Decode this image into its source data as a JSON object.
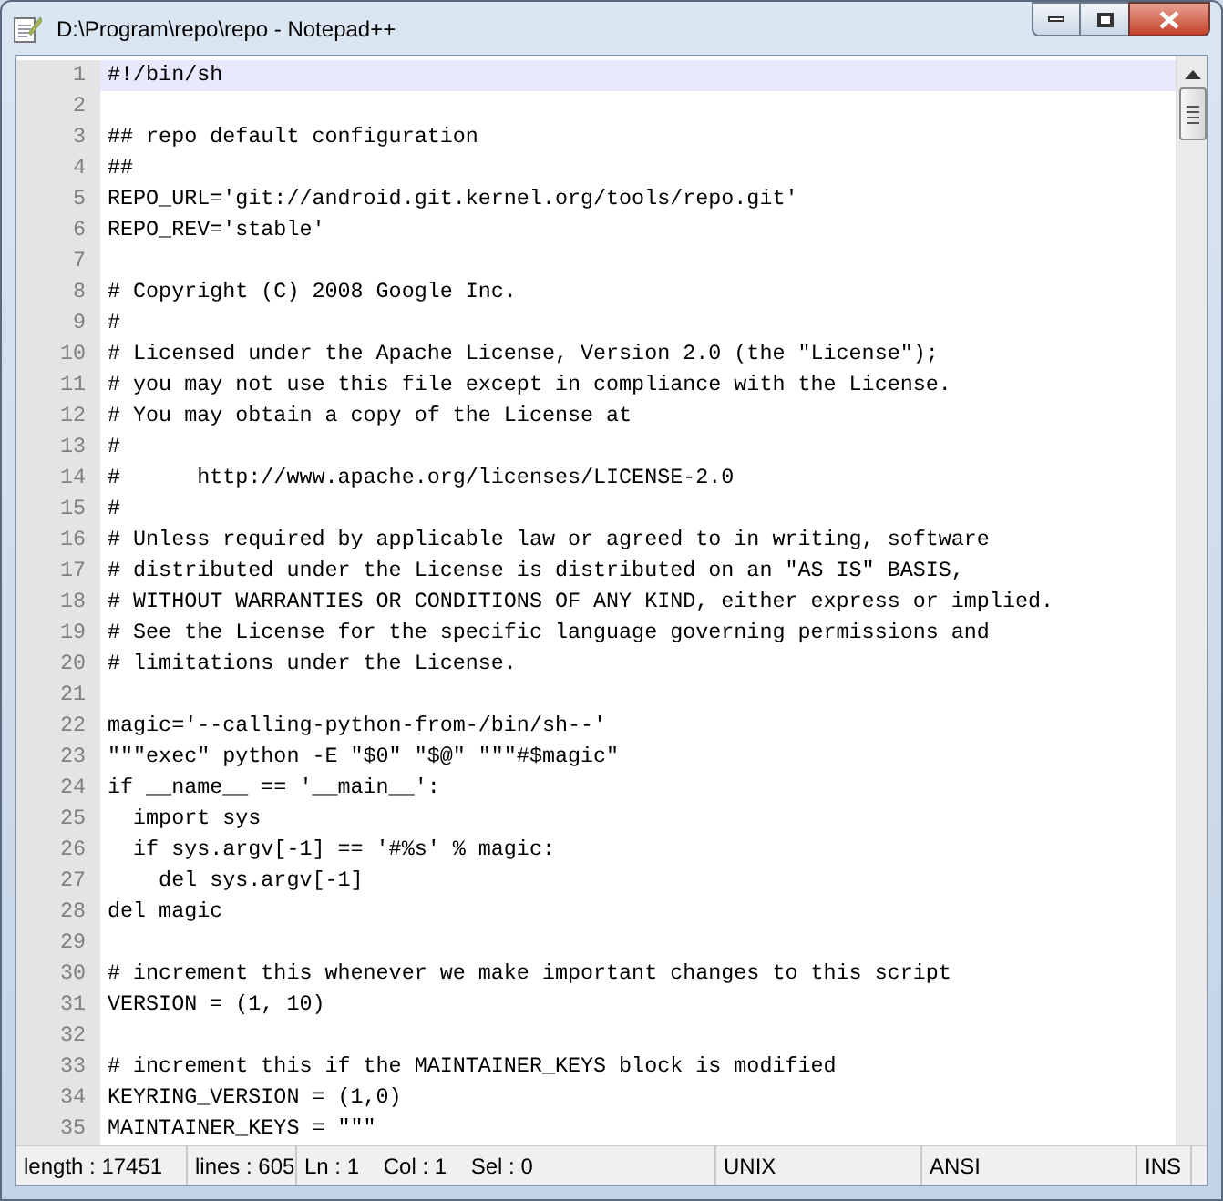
{
  "window": {
    "title": "D:\\Program\\repo\\repo - Notepad++"
  },
  "editor": {
    "lines": [
      {
        "number": "1",
        "text": "#!/bin/sh",
        "current": true
      },
      {
        "number": "2",
        "current": false
      },
      {
        "number": "3",
        "text": "## repo default configuration",
        "current": false
      },
      {
        "number": "4",
        "text": "##",
        "current": false
      },
      {
        "number": "5",
        "text": "REPO_URL='git://android.git.kernel.org/tools/repo.git'",
        "current": false
      },
      {
        "number": "6",
        "text": "REPO_REV='stable'",
        "current": false
      },
      {
        "number": "7",
        "current": false
      },
      {
        "number": "8",
        "text": "# Copyright (C) 2008 Google Inc.",
        "current": false
      },
      {
        "number": "9",
        "text": "#",
        "current": false
      },
      {
        "number": "10",
        "text": "# Licensed under the Apache License, Version 2.0 (the \"License\");",
        "current": false
      },
      {
        "number": "11",
        "text": "# you may not use this file except in compliance with the License.",
        "current": false
      },
      {
        "number": "12",
        "text": "# You may obtain a copy of the License at",
        "current": false
      },
      {
        "number": "13",
        "text": "#",
        "current": false
      },
      {
        "number": "14",
        "text": "#      http://www.apache.org/licenses/LICENSE-2.0",
        "current": false
      },
      {
        "number": "15",
        "text": "#",
        "current": false
      },
      {
        "number": "16",
        "text": "# Unless required by applicable law or agreed to in writing, software",
        "current": false
      },
      {
        "number": "17",
        "text": "# distributed under the License is distributed on an \"AS IS\" BASIS,",
        "current": false
      },
      {
        "number": "18",
        "text": "# WITHOUT WARRANTIES OR CONDITIONS OF ANY KIND, either express or implied.",
        "current": false
      },
      {
        "number": "19",
        "text": "# See the License for the specific language governing permissions and",
        "current": false
      },
      {
        "number": "20",
        "text": "# limitations under the License.",
        "current": false
      },
      {
        "number": "21",
        "current": false
      },
      {
        "number": "22",
        "text": "magic='--calling-python-from-/bin/sh--'",
        "current": false
      },
      {
        "number": "23",
        "text": "\"\"\"exec\" python -E \"$0\" \"$@\" \"\"\"#$magic\"",
        "current": false
      },
      {
        "number": "24",
        "text": "if __name__ == '__main__':",
        "current": false
      },
      {
        "number": "25",
        "text": "  import sys",
        "current": false
      },
      {
        "number": "26",
        "text": "  if sys.argv[-1] == '#%s' % magic:",
        "current": false
      },
      {
        "number": "27",
        "text": "    del sys.argv[-1]",
        "current": false
      },
      {
        "number": "28",
        "text": "del magic",
        "current": false
      },
      {
        "number": "29",
        "current": false
      },
      {
        "number": "30",
        "text": "# increment this whenever we make important changes to this script",
        "current": false
      },
      {
        "number": "31",
        "text": "VERSION = (1, 10)",
        "current": false
      },
      {
        "number": "32",
        "current": false
      },
      {
        "number": "33",
        "text": "# increment this if the MAINTAINER_KEYS block is modified",
        "current": false
      },
      {
        "number": "34",
        "text": "KEYRING_VERSION = (1,0)",
        "current": false
      },
      {
        "number": "35",
        "text": "MAINTAINER_KEYS = \"\"\"",
        "current": false
      }
    ]
  },
  "status_bar": {
    "length": "length : 17451",
    "lines": "lines : 605",
    "position": "Ln : 1    Col : 1    Sel : 0",
    "eol": "UNIX",
    "encoding": "ANSI",
    "mode": "INS"
  }
}
